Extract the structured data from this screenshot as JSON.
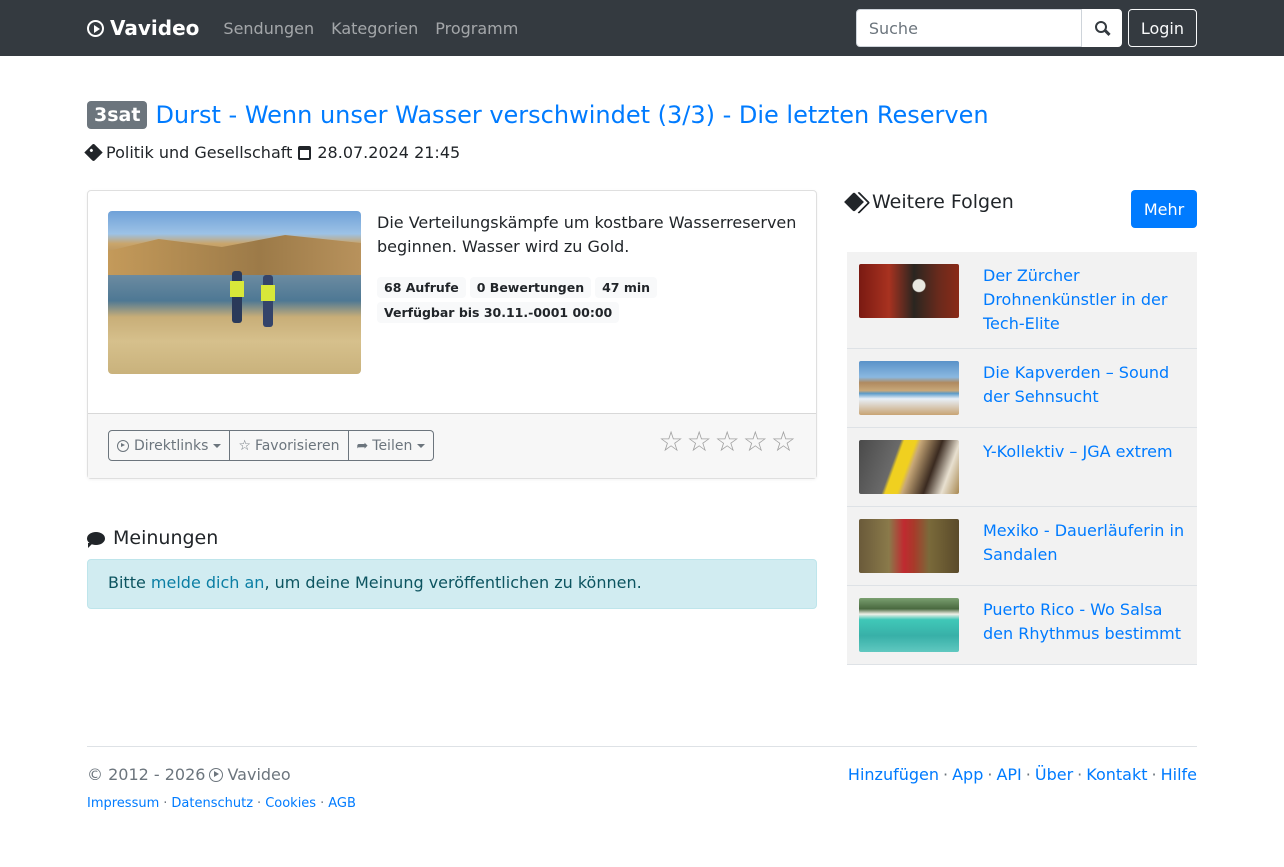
{
  "navbar": {
    "brand": "Vavideo",
    "links": [
      "Sendungen",
      "Kategorien",
      "Programm"
    ],
    "search_placeholder": "Suche",
    "login_label": "Login"
  },
  "video": {
    "channel": "3sat",
    "title": "Durst - Wenn unser Wasser verschwindet (3/3) - Die letzten Reserven",
    "category": "Politik und Gesellschaft",
    "datetime": "28.07.2024 21:45",
    "description": "Die Verteilungskämpfe um kostbare Wasserreserven beginnen. Wasser wird zu Gold.",
    "views": "68 Aufrufe",
    "ratings": "0 Bewertungen",
    "duration": "47 min",
    "available": "Verfügbar bis 30.11.-0001 00:00",
    "rating_stars": 0,
    "actions": {
      "direct": "Direktlinks",
      "favorite": "Favorisieren",
      "share": "Teilen"
    }
  },
  "comments": {
    "heading": "Meinungen",
    "text_before": "Bitte ",
    "login_link": "melde dich an",
    "text_after": ", um deine Meinung veröffentlichen zu können."
  },
  "sidebar": {
    "heading": "Weitere Folgen",
    "more_label": "Mehr",
    "episodes": [
      {
        "title": "Der Zürcher Drohnenkünstler in der Tech-Elite"
      },
      {
        "title": "Die Kapverden – Sound der Sehnsucht"
      },
      {
        "title": "Y-Kollektiv – JGA extrem"
      },
      {
        "title": "Mexiko - Dauerläuferin in Sandalen"
      },
      {
        "title": "Puerto Rico - Wo Salsa den Rhythmus bestimmt"
      }
    ]
  },
  "footer": {
    "copyright": "© 2012 - 2026",
    "brand": "Vavideo",
    "legal": [
      "Impressum",
      "Datenschutz",
      "Cookies",
      "AGB"
    ],
    "links": [
      "Hinzufügen",
      "App",
      "API",
      "Über",
      "Kontakt",
      "Hilfe"
    ]
  }
}
